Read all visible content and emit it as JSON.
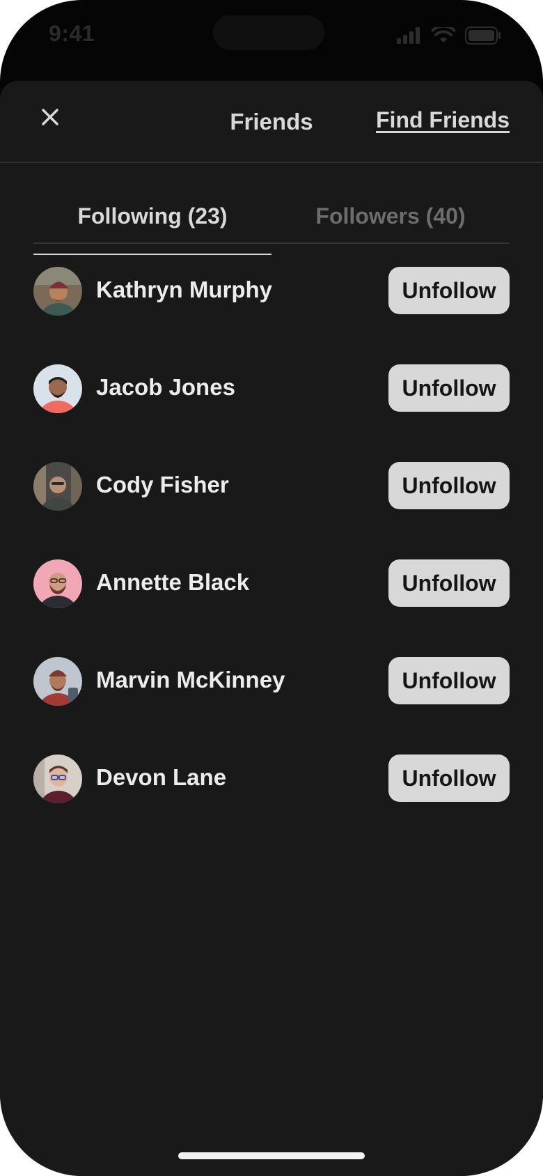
{
  "status_bar": {
    "time": "9:41"
  },
  "header": {
    "close_icon": "close-icon",
    "title": "Friends",
    "find_friends_label": "Find Friends"
  },
  "tabs": [
    {
      "label": "Following (23)",
      "active": true
    },
    {
      "label": "Followers (40)",
      "active": false
    }
  ],
  "following": [
    {
      "name": "Kathryn Murphy",
      "button_label": "Unfollow",
      "avatar_bg": "#7a6b58"
    },
    {
      "name": "Jacob Jones",
      "button_label": "Unfollow",
      "avatar_bg": "#d9e2ea"
    },
    {
      "name": "Cody Fisher",
      "button_label": "Unfollow",
      "avatar_bg": "#4b4a46"
    },
    {
      "name": "Annette Black",
      "button_label": "Unfollow",
      "avatar_bg": "#f2a7b7"
    },
    {
      "name": "Marvin McKinney",
      "button_label": "Unfollow",
      "avatar_bg": "#bfc6cf"
    },
    {
      "name": "Devon Lane",
      "button_label": "Unfollow",
      "avatar_bg": "#d7d0c9"
    }
  ],
  "colors": {
    "background": "#050505",
    "sheet": "#191919",
    "button": "#d8d8d8",
    "text_primary": "#ececec",
    "text_muted": "#6d6d6d"
  }
}
